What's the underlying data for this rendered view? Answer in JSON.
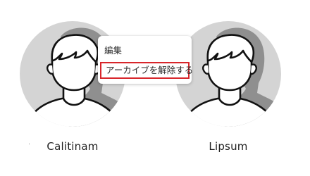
{
  "profiles": [
    {
      "name": "Calitinam"
    },
    {
      "name": "Lipsum"
    }
  ],
  "context_menu": {
    "items": [
      {
        "label": "編集"
      },
      {
        "label": "アーカイブを解除する"
      }
    ]
  },
  "colors": {
    "avatar_bg": "#d4d4d4",
    "avatar_shadow": "#8f8f8f",
    "avatar_line": "#111111",
    "highlight_border": "#d8262b"
  },
  "icons": [
    "user-avatar-icon"
  ]
}
